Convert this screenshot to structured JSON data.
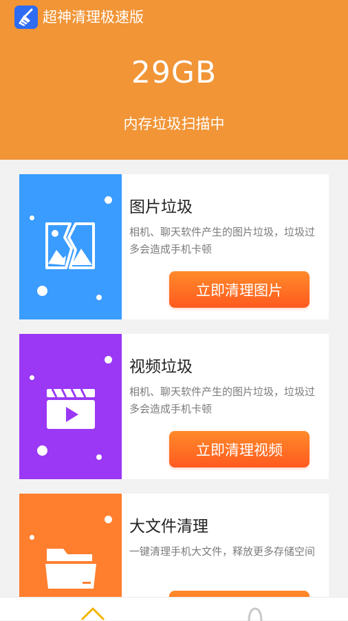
{
  "header": {
    "app_title": "超神清理极速版",
    "storage_size": "29GB",
    "scan_status": "内存垃圾扫描中"
  },
  "cards": [
    {
      "title": "图片垃圾",
      "description": "相机、聊天软件产生的图片垃圾，垃圾过多会造成手机卡顿",
      "button_label": "立即清理图片",
      "icon": "image-icon",
      "color": "#3a9cff"
    },
    {
      "title": "视频垃圾",
      "description": "相机、聊天软件产生的图片垃圾，垃圾过多会造成手机卡顿",
      "button_label": "立即清理视频",
      "icon": "video-icon",
      "color": "#9a38f5"
    },
    {
      "title": "大文件清理",
      "description": "一键清理手机大文件，释放更多存储空间",
      "button_label": "",
      "icon": "folder-icon",
      "color": "#ff7f2e"
    }
  ],
  "bottom_nav": {
    "items": [
      {
        "icon": "home-icon",
        "color": "#f5b400"
      },
      {
        "icon": "bell-icon",
        "color": "#c8c8c8"
      }
    ]
  },
  "colors": {
    "header_bg": "#f19537",
    "button_gradient_top": "#ff8a2a",
    "button_gradient_bottom": "#ff5a1f"
  }
}
